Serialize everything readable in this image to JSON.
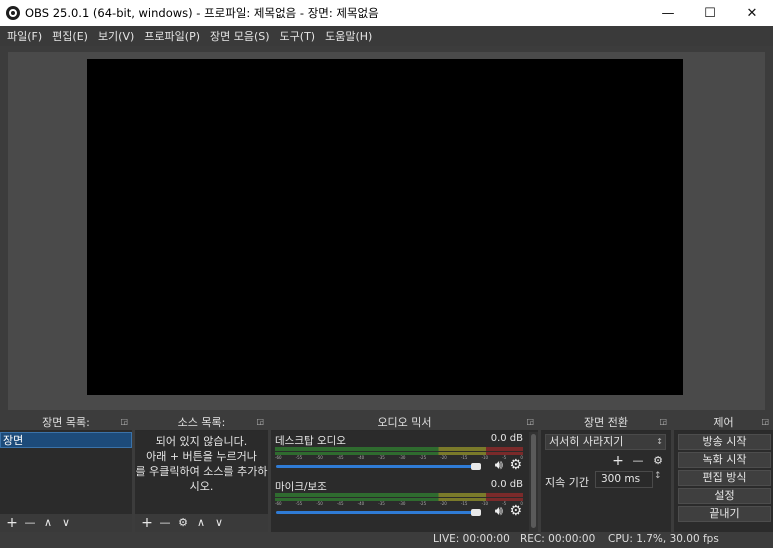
{
  "window": {
    "title": "OBS 25.0.1 (64-bit, windows) - 프로파일: 제목없음 - 장면: 제목없음",
    "minimize": "—",
    "maximize": "☐",
    "close": "✕"
  },
  "menu": [
    "파일(F)",
    "편집(E)",
    "보기(V)",
    "프로파일(P)",
    "장면 모음(S)",
    "도구(T)",
    "도움말(H)"
  ],
  "docks": {
    "scenes": {
      "title": "장면 목록:",
      "items": [
        "장면"
      ]
    },
    "sources": {
      "title": "소스 목록:",
      "empty_lines": [
        "되어 있지 않습니다.",
        "아래 + 버튼을 누르거나",
        "를 우클릭하여 소스를 추가하",
        "시오."
      ]
    },
    "mixer": {
      "title": "오디오 믹서",
      "tracks": [
        {
          "name": "데스크탑 오디오",
          "db": "0.0 dB"
        },
        {
          "name": "마이크/보조",
          "db": "0.0 dB"
        }
      ],
      "scale": [
        "-60",
        "-55",
        "-50",
        "-45",
        "-40",
        "-35",
        "-30",
        "-25",
        "-20",
        "-15",
        "-10",
        "-5",
        "0"
      ]
    },
    "transitions": {
      "title": "장면 전환",
      "selected": "서서히 사라지기",
      "duration_label": "지속 기간",
      "duration_value": "300 ms"
    },
    "controls": {
      "title": "제어",
      "buttons": [
        "방송 시작",
        "녹화 시작",
        "편집 방식",
        "설정",
        "끝내기"
      ]
    }
  },
  "toolbar_glyphs": {
    "add": "+",
    "remove": "—",
    "up": "∧",
    "down": "∨",
    "gear": "⚙"
  },
  "status": {
    "live": "LIVE: 00:00:00",
    "rec": "REC: 00:00:00",
    "cpu": "CPU: 1.7%, 30.00 fps"
  }
}
